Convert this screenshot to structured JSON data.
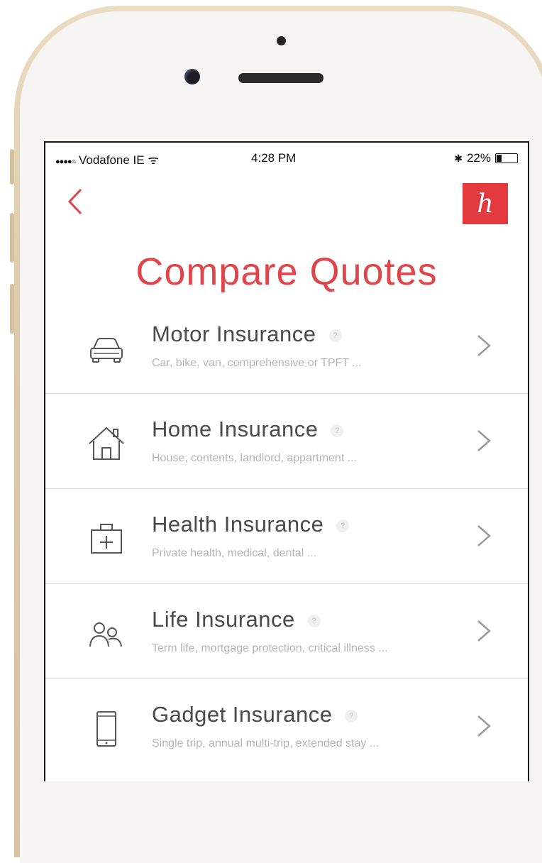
{
  "status_bar": {
    "signal": "●●●●○",
    "carrier": "Vodafone IE",
    "wifi_glyph": "ᯤ",
    "time": "4:28 PM",
    "bluetooth_glyph": "✱",
    "battery_percent": "22%",
    "battery_level": 0.22
  },
  "header": {
    "back_icon": "chevron-left-icon",
    "logo_letter": "h",
    "title": "Compare Quotes"
  },
  "colors": {
    "accent": "#e0454a",
    "logo_bg": "#e23a3f",
    "title_text": "#4a4a4a",
    "subtitle_text": "#b5b5b5"
  },
  "insurance_list": [
    {
      "icon": "car-icon",
      "title": "Motor Insurance",
      "info": "?",
      "subtitle": "Car, bike, van, comprehensive or TPFT ..."
    },
    {
      "icon": "house-icon",
      "title": "Home Insurance",
      "info": "?",
      "subtitle": "House, contents, landlord, appartment ..."
    },
    {
      "icon": "medical-kit-icon",
      "title": "Health Insurance",
      "info": "?",
      "subtitle": "Private health, medical, dental ..."
    },
    {
      "icon": "people-icon",
      "title": "Life Insurance",
      "info": "?",
      "subtitle": "Term life, mortgage protection, critical illness ..."
    },
    {
      "icon": "phone-icon",
      "title": "Gadget Insurance",
      "info": "?",
      "subtitle": "Single trip, annual multi-trip, extended stay ..."
    }
  ]
}
